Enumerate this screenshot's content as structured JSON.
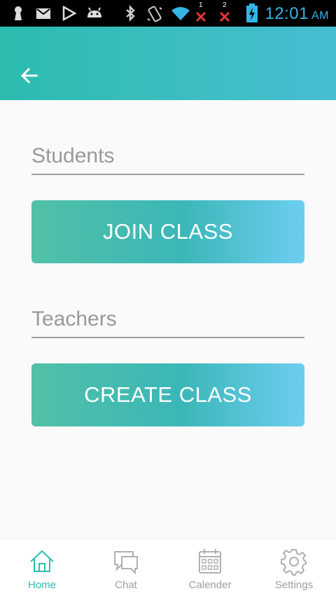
{
  "status_bar": {
    "time": "12:01",
    "ampm": "AM",
    "sim1_label": "1",
    "sim2_label": "2",
    "icons": [
      "keyhole-icon",
      "gmail-icon",
      "play-store-icon",
      "android-icon",
      "bluetooth-icon",
      "vibrate-icon",
      "wifi-icon",
      "sim1-no-signal-icon",
      "sim2-no-signal-icon",
      "battery-charging-icon"
    ],
    "clock_color": "#33b5e5"
  },
  "app_bar": {
    "back_icon": "arrow-back-icon",
    "gradient": [
      "#2bbcaf",
      "#46bdd2"
    ]
  },
  "students": {
    "label": "Students",
    "button_label": "JOIN CLASS"
  },
  "teachers": {
    "label": "Teachers",
    "button_label": "CREATE CLASS"
  },
  "bottom_nav": {
    "items": [
      {
        "label": "Home",
        "icon": "home-icon",
        "active": true
      },
      {
        "label": "Chat",
        "icon": "chat-icon",
        "active": false
      },
      {
        "label": "Calender",
        "icon": "calendar-icon",
        "active": false
      },
      {
        "label": "Settings",
        "icon": "settings-icon",
        "active": false
      }
    ],
    "active_color": "#2cbdb0",
    "inactive_color": "#9e9e9e"
  }
}
